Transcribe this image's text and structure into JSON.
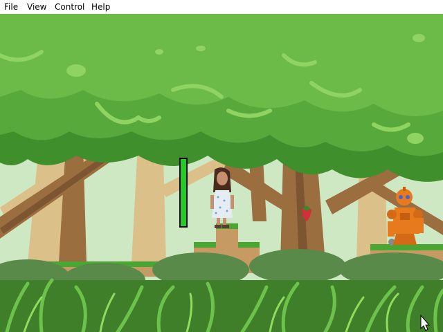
{
  "menubar": {
    "items": [
      {
        "label": "File"
      },
      {
        "label": "View"
      },
      {
        "label": "Control"
      },
      {
        "label": "Help"
      }
    ]
  },
  "game": {
    "player_health_fraction": 1.0,
    "colors": {
      "sky": "#cfe8c4",
      "canopy_dark": "#3f8f2c",
      "canopy_mid": "#58a93c",
      "canopy_light": "#7cc552",
      "trunk": "#9b6e3f",
      "trunk_far": "#cfa86a",
      "grass_top": "#4aa533",
      "dirt": "#c59b63",
      "health_bar": "#22cc22",
      "robot_orange": "#e87a1e"
    },
    "sprites": [
      "player-girl-in-gown",
      "strawberry-pickup",
      "orange-robot-enemy"
    ],
    "cursor": "arrow-cursor"
  }
}
